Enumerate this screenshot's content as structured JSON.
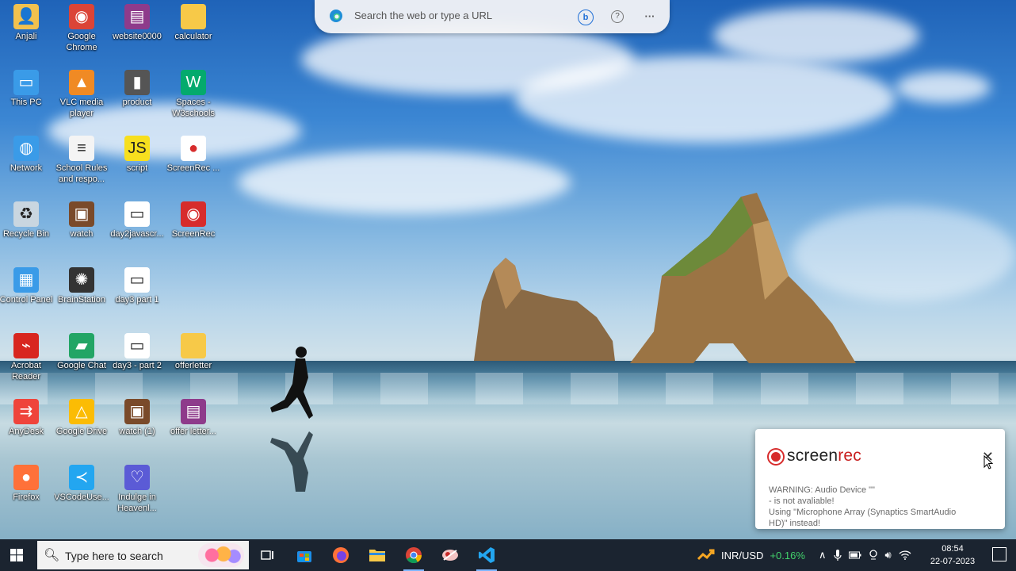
{
  "edge_search": {
    "placeholder": "Search the web or type a URL",
    "icons": [
      "edge-logo-icon",
      "bing-chat-icon",
      "help-icon",
      "more-icon"
    ]
  },
  "desktop_icons": [
    {
      "label": "Anjali",
      "icon": "user-folder-icon"
    },
    {
      "label": "Google Chrome",
      "icon": "chrome-icon"
    },
    {
      "label": "website0000",
      "icon": "winrar-icon"
    },
    {
      "label": "calculator",
      "icon": "folder-icon"
    },
    {
      "label": "This PC",
      "icon": "computer-icon"
    },
    {
      "label": "VLC media player",
      "icon": "vlc-icon"
    },
    {
      "label": "product",
      "icon": "image-file-icon"
    },
    {
      "label": "Spaces - W3schools",
      "icon": "w3schools-icon"
    },
    {
      "label": "Network",
      "icon": "network-icon"
    },
    {
      "label": "School Rules and respo...",
      "icon": "document-icon"
    },
    {
      "label": "script",
      "icon": "js-file-icon"
    },
    {
      "label": "ScreenRec ...",
      "icon": "screenrec-file-icon"
    },
    {
      "label": "Recycle Bin",
      "icon": "recycle-bin-icon"
    },
    {
      "label": "watch",
      "icon": "tv-icon"
    },
    {
      "label": "day2javascr...",
      "icon": "video-file-icon"
    },
    {
      "label": "ScreenRec",
      "icon": "screenrec-icon"
    },
    {
      "label": "Control Panel",
      "icon": "control-panel-icon"
    },
    {
      "label": "BrainStation",
      "icon": "brain-icon"
    },
    {
      "label": "day3 part 1",
      "icon": "video-file-icon"
    },
    {
      "label": "Acrobat Reader",
      "icon": "acrobat-icon"
    },
    {
      "label": "Google Chat",
      "icon": "google-chat-icon"
    },
    {
      "label": "day3 - part 2",
      "icon": "video-file-icon"
    },
    {
      "label": "offerletter",
      "icon": "folder-icon"
    },
    {
      "label": "AnyDesk",
      "icon": "anydesk-icon"
    },
    {
      "label": "Google Drive",
      "icon": "google-drive-icon"
    },
    {
      "label": "watch (1)",
      "icon": "tv-icon"
    },
    {
      "label": "offer letter...",
      "icon": "winrar-icon"
    },
    {
      "label": "Firefox",
      "icon": "firefox-icon"
    },
    {
      "label": "VSCodeUse...",
      "icon": "vscode-icon"
    },
    {
      "label": "Indulge in Heavenl...",
      "icon": "heart-app-icon"
    }
  ],
  "screenrec_popup": {
    "brand_plain": "screen",
    "brand_accent": "rec",
    "close": "✕",
    "message_lines": [
      "WARNING: Audio Device \"\"",
      "- is not avaliable!",
      "Using \"Microphone Array (Synaptics SmartAudio",
      "HD)\" instead!"
    ]
  },
  "taskbar": {
    "search_placeholder": "Type here to search",
    "apps": [
      {
        "name": "task-view",
        "icon": "task-view-icon"
      },
      {
        "name": "store",
        "icon": "store-icon"
      },
      {
        "name": "firefox",
        "icon": "firefox-icon"
      },
      {
        "name": "file-explorer",
        "icon": "folder-icon"
      },
      {
        "name": "chrome",
        "icon": "chrome-icon"
      },
      {
        "name": "snipping-tool",
        "icon": "snip-icon"
      },
      {
        "name": "vscode",
        "icon": "vscode-icon"
      }
    ],
    "currency_label": "INR/USD",
    "currency_change": "+0.16%",
    "time": "08:54",
    "date": "22-07-2023"
  },
  "colors": {
    "taskbar_bg": "#1b2430",
    "screenrec_red": "#d72c2c",
    "currency_green": "#42d16b"
  }
}
